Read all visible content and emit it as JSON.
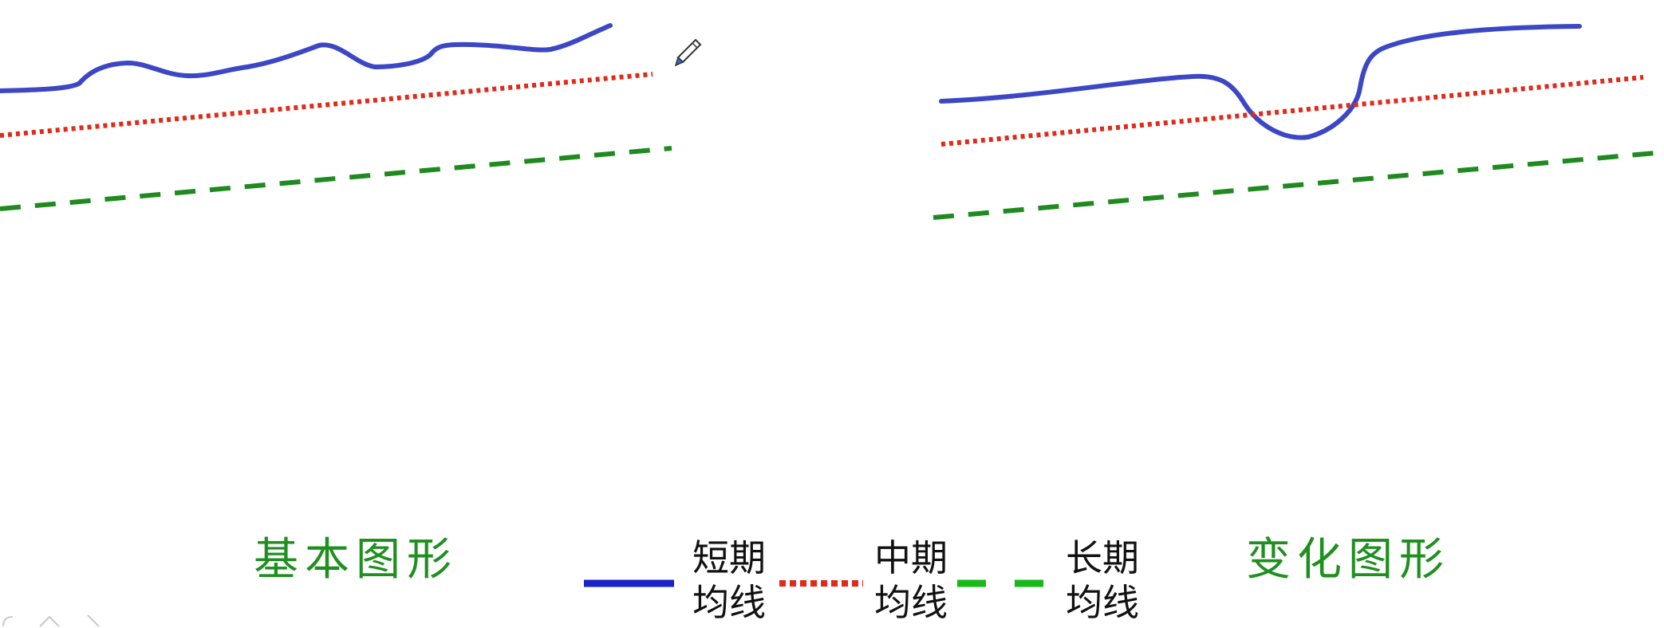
{
  "left_figure": {
    "caption": "基本图形"
  },
  "right_figure": {
    "caption": "变化图形"
  },
  "legend": [
    {
      "key": "short",
      "label": "短期均线",
      "color": "#1a22c8",
      "style": "solid"
    },
    {
      "key": "mid",
      "label": "中期均线",
      "color": "#e02a1a",
      "style": "dotted"
    },
    {
      "key": "long",
      "label": "长期均线",
      "color": "#18b818",
      "style": "dashed"
    }
  ],
  "colors": {
    "short_curve": "#3b47c4",
    "mid_line": "#e02a1a",
    "long_line": "#1f8a1f",
    "caption": "#1f8f1f"
  },
  "icons": [
    "pen-cursor-icon",
    "slide-nav-icon"
  ]
}
